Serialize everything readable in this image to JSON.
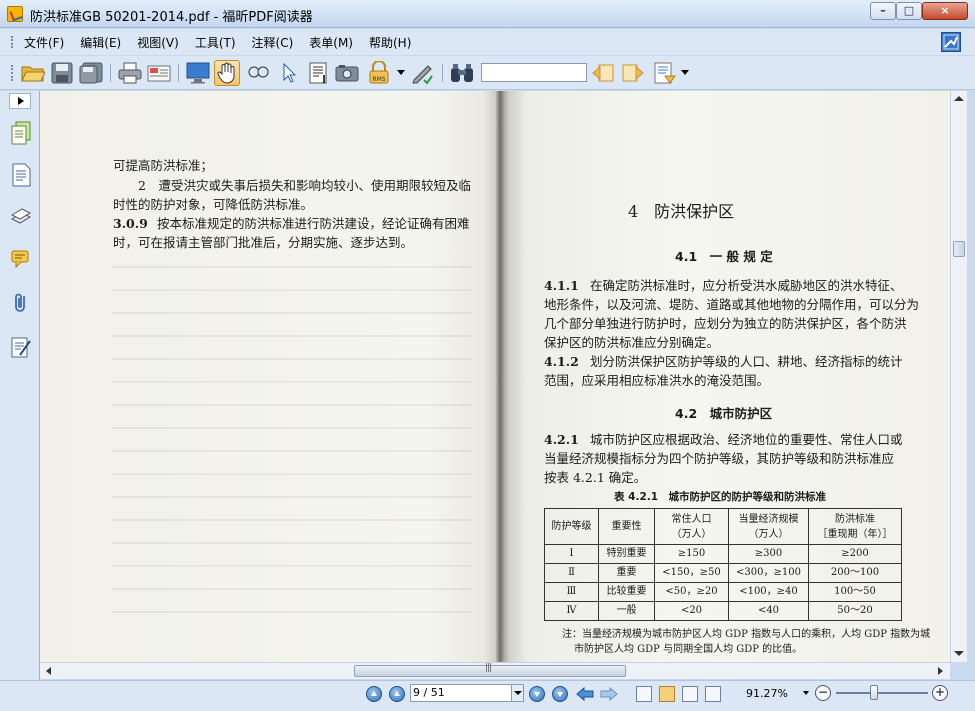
{
  "window": {
    "title": "防洪标准GB 50201-2014.pdf - 福昕PDF阅读器",
    "minimize": "–",
    "maximize": "□",
    "close": "×"
  },
  "menu": {
    "items": [
      "文件(F)",
      "编辑(E)",
      "视图(V)",
      "工具(T)",
      "注释(C)",
      "表单(M)",
      "帮助(H)"
    ]
  },
  "toolbar": {
    "search_value": "",
    "tools": [
      "open-icon",
      "save-icon",
      "save-as-icon",
      "print-icon",
      "email-icon",
      "fullscreen-icon",
      "hand-icon",
      "zoom-glass-icon",
      "select-arrow-icon",
      "text-select-icon",
      "snapshot-icon",
      "rms-lock-icon",
      "sign-icon",
      "find-binoculars-icon",
      "prev-result-icon",
      "next-result-icon",
      "highlight-icon"
    ],
    "active_tool": "hand-icon"
  },
  "left_panel": {
    "icons": [
      "pages-icon",
      "bookmarks-icon",
      "layers-icon",
      "comments-icon",
      "attachments-icon",
      "signatures-icon"
    ]
  },
  "document": {
    "left_page": {
      "lines": [
        "可提高防洪标准；",
        "　　2　遭受洪灾或失事后损失和影响均较小、使用期限较短及临",
        "时性的防护对象，可降低防洪标准。",
        "按本标准规定的防洪标准进行防洪建设，经论证确有困难",
        "时，可在报请主管部门批准后，分期实施、逐步达到。"
      ],
      "clause_number": "3.0.9"
    },
    "right_page": {
      "chapter": "4　防洪保护区",
      "section_41": "4.1　一 般 规 定",
      "clause_411_num": "4.1.1",
      "clause_411": [
        "在确定防洪标准时，应分析受洪水威胁地区的洪水特征、",
        "地形条件，以及河流、堤防、道路或其他地物的分隔作用，可以分为",
        "几个部分单独进行防护时，应划分为独立的防洪保护区，各个防洪",
        "保护区的防洪标准应分别确定。"
      ],
      "clause_412_num": "4.1.2",
      "clause_412": [
        "划分防洪保护区防护等级的人口、耕地、经济指标的统计",
        "范围，应采用相应标准洪水的淹没范围。"
      ],
      "section_42": "4.2　城市防护区",
      "clause_421_num": "4.2.1",
      "clause_421": [
        "城市防护区应根据政治、经济地位的重要性、常住人口或",
        "当量经济规模指标分为四个防护等级，其防护等级和防洪标准应",
        "按表 4.2.1 确定。"
      ],
      "table": {
        "caption": "表 4.2.1　城市防护区的防护等级和防洪标准",
        "headers": [
          "防护等级",
          "重要性",
          "常住人口\n（万人）",
          "当量经济规模\n（万人）",
          "防洪标准\n［重现期（年）］"
        ],
        "rows": [
          [
            "Ⅰ",
            "特别重要",
            "≥150",
            "≥300",
            "≥200"
          ],
          [
            "Ⅱ",
            "重要",
            "<150，≥50",
            "<300，≥100",
            "200～100"
          ],
          [
            "Ⅲ",
            "比较重要",
            "<50，≥20",
            "<100，≥40",
            "100～50"
          ],
          [
            "Ⅳ",
            "一般",
            "<20",
            "<40",
            "50～20"
          ]
        ],
        "note": [
          "注：当量经济规模为城市防护区人均 GDP 指数与人口的乘积，人均 GDP 指数为城",
          "市防护区人均 GDP 与同期全国人均 GDP 的比值。"
        ]
      }
    }
  },
  "statusbar": {
    "page_field": "9 / 51",
    "zoom": "91.27%",
    "zoom_minus": "−",
    "zoom_plus": "+"
  },
  "colors": {
    "chrome": "#dce7f5",
    "titlebar": "#c5d7ef",
    "page": "#f4f4ef",
    "active_tool": "#f3c46a"
  }
}
